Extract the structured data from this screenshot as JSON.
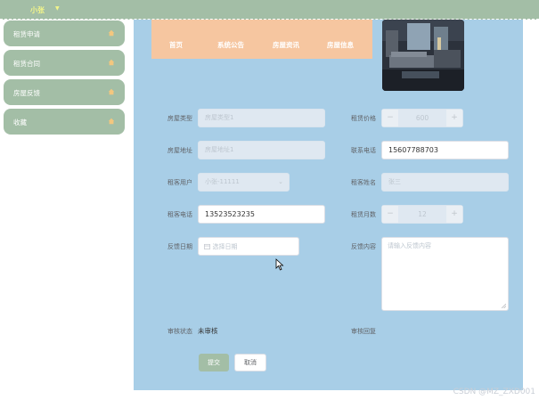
{
  "topbar": {
    "user": "小张",
    "caret": "▼"
  },
  "sidebar": {
    "items": [
      {
        "label": "租赁申请",
        "icon": "home-icon"
      },
      {
        "label": "租赁合同",
        "icon": "home-icon"
      },
      {
        "label": "房屋反馈",
        "icon": "home-icon"
      },
      {
        "label": "收藏",
        "icon": "home-icon"
      }
    ]
  },
  "nav": {
    "items": [
      "首页",
      "系统公告",
      "房屋资讯",
      "房屋信息"
    ]
  },
  "form": {
    "house_type": {
      "label": "房屋类型",
      "placeholder": "房屋类型1"
    },
    "rent_price": {
      "label": "租赁价格",
      "value": "600"
    },
    "house_address": {
      "label": "房屋地址",
      "placeholder": "房屋地址1"
    },
    "contact_phone": {
      "label": "联系电话",
      "value": "15607788703"
    },
    "tenant_user": {
      "label": "租客用户",
      "value": "小张-11111"
    },
    "tenant_name": {
      "label": "租客姓名",
      "value": "张三"
    },
    "tenant_phone": {
      "label": "租客电话",
      "value": "13523523235"
    },
    "rent_months": {
      "label": "租赁月数",
      "value": "12"
    },
    "feedback_date": {
      "label": "反馈日期",
      "placeholder": "选择日期"
    },
    "feedback_content": {
      "label": "反馈内容",
      "placeholder": "请输入反馈内容"
    },
    "audit_status": {
      "label": "审核状态",
      "value": "未审核"
    },
    "audit_reply": {
      "label": "审核回复"
    },
    "submit_label": "提交",
    "cancel_label": "取消"
  },
  "watermark": "CSDN @MZ_ZXD001",
  "colors": {
    "topbar": "#a3bea6",
    "main_bg": "#a8cee7",
    "nav_bg": "#f6c6a0",
    "sidebar_item": "#a3bea6"
  }
}
